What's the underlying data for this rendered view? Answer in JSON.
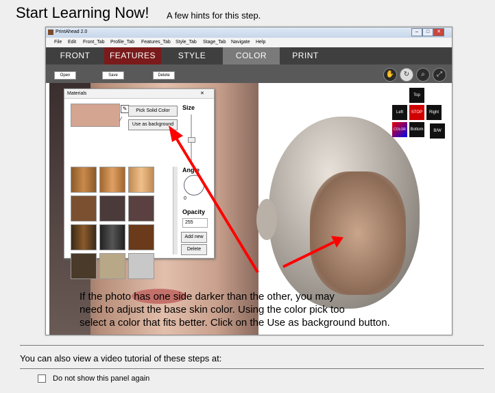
{
  "header": {
    "title": "Start Learning Now!",
    "subtitle": "A few hints for this step."
  },
  "app": {
    "window_title": "PrintAhead 2.0",
    "menu": [
      "File",
      "Edit",
      "Front_Tab",
      "Profile_Tab",
      "Features_Tab",
      "Style_Tab",
      "Stage_Tab",
      "Navigate",
      "Help"
    ],
    "tabs": [
      "FRONT",
      "FEATURES",
      "STYLE",
      "COLOR",
      "PRINT"
    ],
    "active_tab": "COLOR",
    "toolbar": {
      "open": "Open",
      "save": "Save",
      "delete": "Delete"
    },
    "materials": {
      "title": "Materials",
      "pick_solid_color": "Pick Solid Color",
      "use_as_background": "Use as background",
      "size_label": "Size",
      "angle_label": "Angle",
      "angle_value": "0",
      "opacity_label": "Opacity",
      "opacity_value": "255",
      "add_new": "Add new",
      "delete": "Delete",
      "selected_color": "#d4a590"
    },
    "nav": {
      "top": "Top",
      "left": "Left",
      "stop": "STOP",
      "right": "Right",
      "bottom": "Bottom",
      "color": "COLOR",
      "bw": "B/W"
    },
    "caption": [
      "If the photo has one side darker than the other, you may",
      "need to adjust the base skin color. Using the color pick too",
      "select a color that fits better. Click on the Use as background button."
    ]
  },
  "footer": {
    "video_text": "You can also view a video tutorial of these steps at:",
    "dont_show": "Do not show this panel again"
  },
  "colors": {
    "arrow": "#ff0000",
    "tabbar": "#3f3f3f",
    "active_tab": "#7a7a7a",
    "features_tab": "#7a1a1a"
  }
}
